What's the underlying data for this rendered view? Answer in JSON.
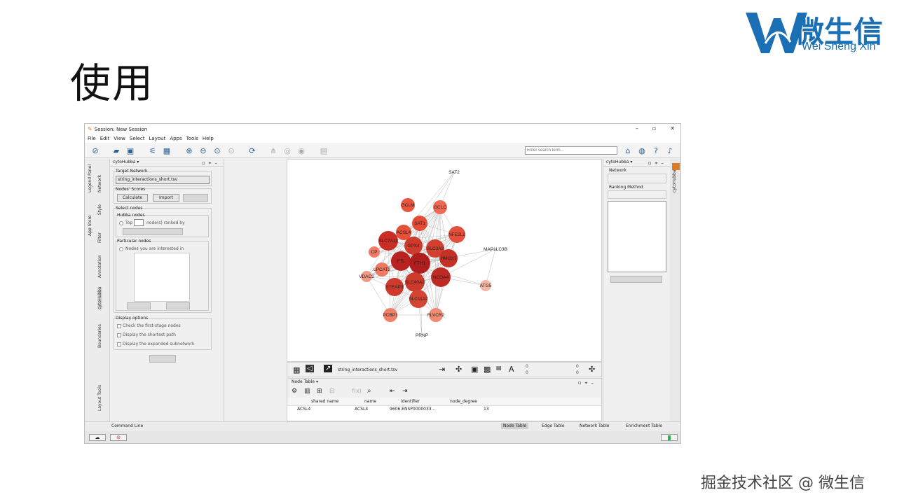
{
  "slide": {
    "title": "使用",
    "logo_cn": "微生信",
    "logo_en": "Wei Sheng Xin",
    "footer": "掘金技术社区 @ 微生信"
  },
  "window": {
    "title": "Session: New Session",
    "controls": [
      "–",
      "▫",
      "✕"
    ],
    "menu": [
      "File",
      "Edit",
      "View",
      "Select",
      "Layout",
      "Apps",
      "Tools",
      "Help"
    ],
    "search_placeholder": "Enter search term..."
  },
  "left_tabs": [
    "Legend Panel",
    "Network",
    "Style",
    "App Store",
    "Filter",
    "Annotation",
    "cytoHubba",
    "Boundaries",
    "Layout Tools"
  ],
  "control_panel": {
    "header": "cytoHubba ▾",
    "target_network_label": "Target Network",
    "target_network_value": "string_interactions_short.tsv",
    "nodes_scores_label": "Nodes' Scores",
    "calculate_label": "Calculate",
    "import_label": "Import",
    "select_nodes_label": "Select nodes",
    "hubba_nodes_label": "Hubba nodes",
    "top_label": "Top",
    "ranked_by_label": "node(s) ranked by",
    "particular_nodes_label": "Particular nodes",
    "interested_label": "Nodes you are interested in",
    "display_options_label": "Display options",
    "opt_first_stage": "Check the first-stage nodes",
    "opt_shortest_path": "Display the shortest path",
    "opt_expanded": "Display the expanded subnetwork"
  },
  "network": {
    "name": "string_interactions_short.tsv",
    "counts": [
      "0",
      "0",
      "0",
      "0"
    ],
    "nodes": [
      {
        "label": "SAT2",
        "color": "#ffffff"
      },
      {
        "label": "GCLM",
        "color": "#e8563f"
      },
      {
        "label": "GCLC",
        "color": "#ee6a52"
      },
      {
        "label": "SAT1",
        "color": "#e44a36"
      },
      {
        "label": "ACSL4",
        "color": "#e4503a"
      },
      {
        "label": "NFE2L2",
        "color": "#e2503b"
      },
      {
        "label": "SLC7A11",
        "color": "#c92d25"
      },
      {
        "label": "GPX4",
        "color": "#cf3a2d"
      },
      {
        "label": "SLC3A2",
        "color": "#d4402f"
      },
      {
        "label": "HMOX1",
        "color": "#c63126"
      },
      {
        "label": "MAP1LC3B",
        "color": "#ffffff"
      },
      {
        "label": "CP",
        "color": "#f07a62"
      },
      {
        "label": "FTL",
        "color": "#b82322"
      },
      {
        "label": "FTH1",
        "color": "#b01d1f"
      },
      {
        "label": "LPCAT3",
        "color": "#ef7a62"
      },
      {
        "label": "VDAC2",
        "color": "#f29a84"
      },
      {
        "label": "NCOA4",
        "color": "#bf2a23"
      },
      {
        "label": "SLC40A1",
        "color": "#cc3a2c"
      },
      {
        "label": "STEAP3",
        "color": "#d03a2c"
      },
      {
        "label": "ATG5",
        "color": "#f5b5a4"
      },
      {
        "label": "SLC11A2",
        "color": "#d54432"
      },
      {
        "label": "PCBP1",
        "color": "#f18068"
      },
      {
        "label": "FLVCR2",
        "color": "#f08a72"
      },
      {
        "label": "PRNP",
        "color": "#ffffff"
      }
    ]
  },
  "right_panel": {
    "header": "cytoHubba ▾",
    "network_label": "Network",
    "ranking_label": "Ranking Method",
    "side_tab": "cytoHubba"
  },
  "table_panel": {
    "header": "Node Table ▾",
    "columns": [
      "shared name",
      "name",
      "identifier",
      "node_degree"
    ],
    "row": [
      "ACSL4",
      "ACSL4",
      "9606.ENSP0000033...",
      "13"
    ]
  },
  "bottom": {
    "command_line": "Command Line",
    "tabs": [
      "Node Table",
      "Edge Table",
      "Network Table",
      "Enrichment Table"
    ]
  }
}
